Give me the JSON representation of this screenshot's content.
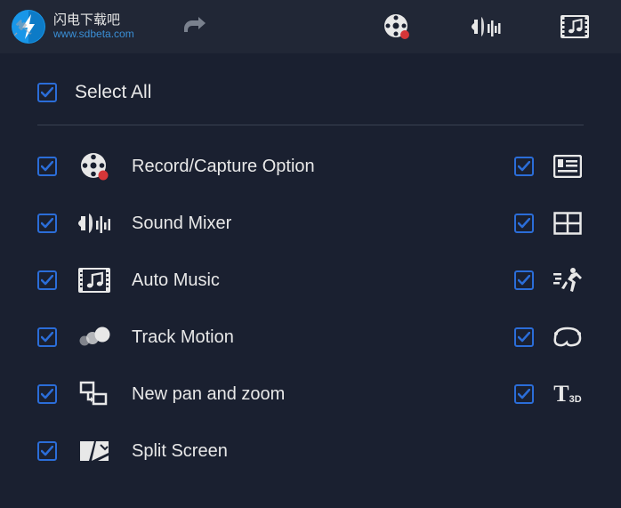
{
  "logo": {
    "title": "闪电下载吧",
    "url": "www.sdbeta.com"
  },
  "select_all": {
    "label": "Select All",
    "checked": true
  },
  "left_items": [
    {
      "icon": "record-capture-icon",
      "label": "Record/Capture Option",
      "checked": true
    },
    {
      "icon": "sound-mixer-icon",
      "label": "Sound Mixer",
      "checked": true
    },
    {
      "icon": "auto-music-icon",
      "label": "Auto Music",
      "checked": true
    },
    {
      "icon": "track-motion-icon",
      "label": "Track Motion",
      "checked": true
    },
    {
      "icon": "pan-zoom-icon",
      "label": "New pan and zoom",
      "checked": true
    },
    {
      "icon": "split-screen-icon",
      "label": "Split Screen",
      "checked": true
    }
  ],
  "right_items": [
    {
      "icon": "subtitle-icon",
      "checked": true
    },
    {
      "icon": "grid-icon",
      "checked": true
    },
    {
      "icon": "motion-man-icon",
      "checked": true
    },
    {
      "icon": "shape-path-icon",
      "checked": true
    },
    {
      "icon": "t3d-icon",
      "checked": true,
      "t3d_main": "T",
      "t3d_sub": "3D"
    }
  ]
}
